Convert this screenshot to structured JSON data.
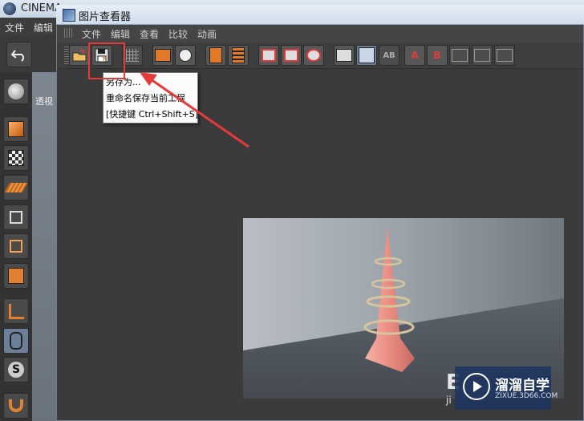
{
  "main_window": {
    "title": "CINEMA",
    "menu": [
      "文件",
      "编辑"
    ],
    "viewport_label": "透视"
  },
  "picture_viewer": {
    "title": "图片查看器",
    "menu": [
      "文件",
      "编辑",
      "查看",
      "比较",
      "动画"
    ]
  },
  "tooltip": {
    "save_as": "另存为...",
    "rename_save": "重命名保存当前工程",
    "shortcut": "[快捷键 Ctrl+Shift+S]"
  },
  "toolbar": {
    "compare_a_label": "A",
    "compare_b_label": "B",
    "ab_label": "AB"
  },
  "watermark": {
    "title": "溜溜自学",
    "url": "ZIXUE.3D66.COM",
    "partial_text": "ji"
  },
  "colors": {
    "highlight_red": "#e53a3a",
    "toolbar_orange": "#e07a2a"
  }
}
